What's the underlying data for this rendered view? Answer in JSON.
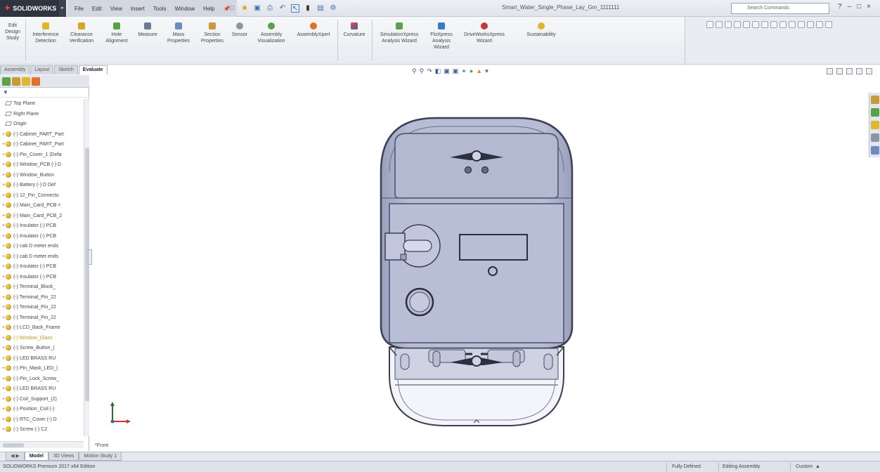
{
  "app": {
    "name": "SOLIDWORKS",
    "document_title": "Smart_Water_Single_Phase_Lay_Gm_1111111"
  },
  "menu": [
    "File",
    "Edit",
    "View",
    "Insert",
    "Tools",
    "Window",
    "Help"
  ],
  "search": {
    "placeholder": "Search Commands"
  },
  "ribbon": {
    "first_button": "Edit Design Study",
    "buttons": [
      "Interference Detection",
      "Clearance Verification",
      "Hole Alignment",
      "Measure",
      "Mass Properties",
      "Section Properties",
      "Sensor",
      "Assembly Visualization",
      "AssemblyXpert",
      "Curvature",
      "SimulationXpress Analysis Wizard",
      "FloXpress Analysis Wizard",
      "DriveWorksXpress Wizard",
      "Sustainability"
    ]
  },
  "command_tabs": [
    "Assembly",
    "Layout",
    "Sketch",
    "Evaluate"
  ],
  "active_command_tab": "Evaluate",
  "feature_tree": [
    {
      "label": "Top Plane",
      "kind": "plane"
    },
    {
      "label": "Right Plane",
      "kind": "plane"
    },
    {
      "label": "Origin",
      "kind": "origin"
    },
    {
      "label": "(-) Cabinet_PART_Part",
      "kind": "part"
    },
    {
      "label": "(-) Cabinet_PART_Part",
      "kind": "part"
    },
    {
      "label": "(-) Pin_Cover_1 (Defa",
      "kind": "part"
    },
    {
      "label": "(-) Window_PCB (-) D",
      "kind": "part"
    },
    {
      "label": "(-) Window_Button",
      "kind": "part"
    },
    {
      "label": "(-) Battery (-) D Def",
      "kind": "part"
    },
    {
      "label": "(-) 12_Pin_Connecto",
      "kind": "part"
    },
    {
      "label": "(-) Main_Card_PCB <",
      "kind": "part"
    },
    {
      "label": "(-) Main_Card_PCB_2",
      "kind": "part"
    },
    {
      "label": "(-) Insulator (-) PCB",
      "kind": "part"
    },
    {
      "label": "(-) Insulator (-) PCB",
      "kind": "part"
    },
    {
      "label": "(-) cab D meter ends",
      "kind": "part"
    },
    {
      "label": "(-) cab D meter ends",
      "kind": "part"
    },
    {
      "label": "(-) Insulator (-) PCB",
      "kind": "part"
    },
    {
      "label": "(-) Insulator (-) PCB",
      "kind": "part"
    },
    {
      "label": "(-) Terminal_Block_",
      "kind": "part"
    },
    {
      "label": "(-) Terminal_Pin_22",
      "kind": "part"
    },
    {
      "label": "(-) Terminal_Pin_22",
      "kind": "part"
    },
    {
      "label": "(-) Terminal_Pin_22",
      "kind": "part"
    },
    {
      "label": "(-) LCD_Back_Frame",
      "kind": "part"
    },
    {
      "label": "(-) Window_Glass",
      "kind": "part",
      "highlight": true
    },
    {
      "label": "(-) Screw_Button_(",
      "kind": "part"
    },
    {
      "label": "(-) LED BRASS RU",
      "kind": "part"
    },
    {
      "label": "(-) Pin_Mask_LED_(",
      "kind": "part"
    },
    {
      "label": "(-) Pin_Lock_Screw_",
      "kind": "part"
    },
    {
      "label": "(-) LED BRASS RU",
      "kind": "part"
    },
    {
      "label": "(-) Coil_Support_(2)",
      "kind": "part"
    },
    {
      "label": "(-) Position_Coil (-)",
      "kind": "part"
    },
    {
      "label": "(-) RTC_Cover (-) D",
      "kind": "part"
    },
    {
      "label": "(-) Screw (-) C2",
      "kind": "part"
    }
  ],
  "bottom_tabs": [
    "Model",
    "3D Views",
    "Motion Study 1"
  ],
  "active_bottom_tab": "Model",
  "view_label": "*Front",
  "status": {
    "left": "SOLIDWORKS Premium 2017 x64 Edition",
    "defined": "Fully Defined",
    "mode": "Editing Assembly",
    "units": "Custom"
  },
  "colors": {
    "part_fill": "#b6bbd4",
    "part_stroke": "#3c3f52",
    "accent": "#3a64a8"
  }
}
